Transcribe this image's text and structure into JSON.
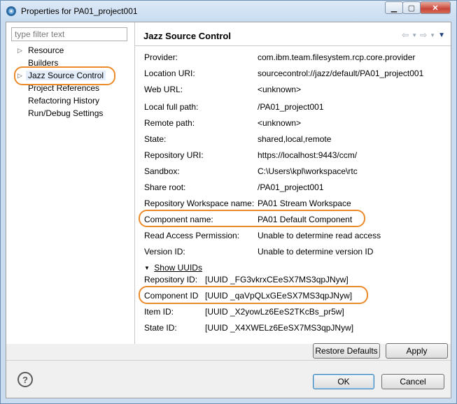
{
  "window": {
    "title": "Properties for PA01_project001"
  },
  "filter": {
    "placeholder": "type filter text"
  },
  "tree": {
    "items": [
      {
        "label": "Resource",
        "expandable": true
      },
      {
        "label": "Builders",
        "expandable": false
      },
      {
        "label": "Jazz Source Control",
        "expandable": true,
        "selected": true
      },
      {
        "label": "Project References",
        "expandable": false
      },
      {
        "label": "Refactoring History",
        "expandable": false
      },
      {
        "label": "Run/Debug Settings",
        "expandable": false
      }
    ]
  },
  "page": {
    "title": "Jazz Source Control",
    "properties": [
      {
        "label": "Provider:",
        "value": "com.ibm.team.filesystem.rcp.core.provider"
      },
      {
        "label": "Location URI:",
        "value": "sourcecontrol://jazz/default/PA01_project001"
      },
      {
        "label": "Web URL:",
        "value": "<unknown>"
      },
      {
        "label": "Local full path:",
        "value": "/PA01_project001"
      },
      {
        "label": "Remote path:",
        "value": "<unknown>"
      },
      {
        "label": "State:",
        "value": "shared,local,remote"
      },
      {
        "label": "Repository URI:",
        "value": "https://localhost:9443/ccm/"
      },
      {
        "label": "Sandbox:",
        "value": "C:\\Users\\kpl\\workspace\\rtc"
      },
      {
        "label": "Share root:",
        "value": "/PA01_project001"
      },
      {
        "label": "Repository Workspace name:",
        "value": "PA01 Stream Workspace"
      },
      {
        "label": "Component name:",
        "value": "PA01 Default Component"
      },
      {
        "label": "Read Access Permission:",
        "value": "Unable to determine read access"
      },
      {
        "label": "Version ID:",
        "value": "Unable to determine version ID"
      }
    ],
    "show_uuids_label": "Show UUIDs",
    "uuids": [
      {
        "label": "Repository ID:",
        "value": "[UUID _FG3vkrxCEeSX7MS3qpJNyw]"
      },
      {
        "label": "Component ID",
        "value": "[UUID _qaVpQLxGEeSX7MS3qpJNyw]"
      },
      {
        "label": "Item ID:",
        "value": "[UUID _X2yowLz6EeS2TKcBs_pr5w]"
      },
      {
        "label": "State ID:",
        "value": "[UUID _X4XWELz6EeSX7MS3qpJNyw]"
      }
    ]
  },
  "buttons": {
    "restore_defaults": "Restore Defaults",
    "apply": "Apply",
    "ok": "OK",
    "cancel": "Cancel"
  },
  "icons": {
    "app": "eclipse-icon",
    "help": "help-icon",
    "back": "back-arrow-icon",
    "forward": "forward-arrow-icon",
    "menu": "view-menu-icon"
  },
  "colors": {
    "highlight": "#ec8a2a",
    "title_bar": "#c9dcf0"
  }
}
